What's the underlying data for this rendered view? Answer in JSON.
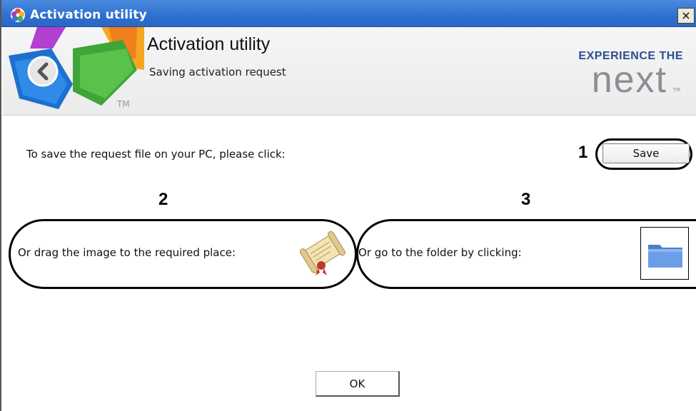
{
  "window": {
    "title": "Activation utility",
    "close_label": "×"
  },
  "header": {
    "title": "Activation utility",
    "subtitle": "Saving activation request",
    "logo_tm": "TM",
    "brand_line1": "EXPERIENCE THE",
    "brand_line2": "next",
    "brand_tm": "TM"
  },
  "content": {
    "save_prompt": "To save the request file on your PC, please click:",
    "save_button_label": "Save",
    "drag_prompt": "Or drag the image to the required place:",
    "folder_prompt": "Or go to the folder by clicking:",
    "step_numbers": [
      "1",
      "2",
      "3"
    ]
  },
  "footer": {
    "ok_label": "OK"
  },
  "icons": {
    "app": "app-logo-icon",
    "back": "back-arrow-icon",
    "scroll": "scroll-document-icon",
    "folder": "folder-icon"
  },
  "colors": {
    "titlebar": "#2e6fcf",
    "brand_blue": "#2a4f8f",
    "brand_gray": "#8a8f96",
    "folder_blue": "#5b8fd6"
  }
}
